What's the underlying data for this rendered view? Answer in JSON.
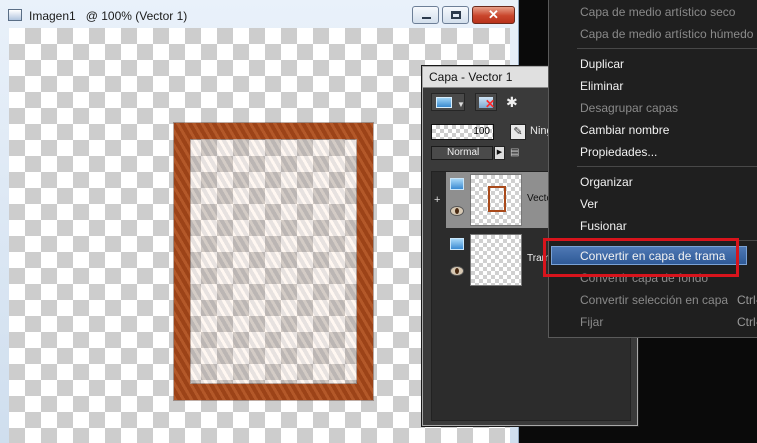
{
  "image_window": {
    "doc_name": "Imagen1",
    "zoom_info": "@ 100% (Vector 1)",
    "close_glyph": "✕"
  },
  "layer_panel": {
    "title": "Capa - Vector 1",
    "opacity": "100",
    "mode_label": "Ning",
    "blend_mode": "Normal",
    "layers": [
      {
        "name": "Vector",
        "type": "vector",
        "selected": true,
        "visible": true,
        "expand": "+"
      },
      {
        "name": "Tram",
        "type": "raster",
        "selected": false,
        "visible": true
      }
    ]
  },
  "context_menu": {
    "items": [
      {
        "label": "Capa de medio artístico seco",
        "enabled": false
      },
      {
        "label": "Capa de medio artístico húmedo",
        "enabled": false
      },
      {
        "label": "Duplicar",
        "enabled": true
      },
      {
        "label": "Eliminar",
        "enabled": true
      },
      {
        "label": "Desagrupar capas",
        "enabled": false
      },
      {
        "label": "Cambiar nombre",
        "enabled": true
      },
      {
        "label": "Propiedades...",
        "enabled": true
      },
      {
        "label": "Organizar",
        "enabled": true
      },
      {
        "label": "Ver",
        "enabled": true
      },
      {
        "label": "Fusionar",
        "enabled": true
      },
      {
        "label": "Convertir en capa de trama",
        "enabled": true,
        "highlighted": true
      },
      {
        "label": "Convertir capa de fondo",
        "enabled": false
      },
      {
        "label": "Convertir selección en capa",
        "enabled": false,
        "shortcut": "Ctrl-"
      },
      {
        "label": "Fijar",
        "enabled": false,
        "shortcut": "Ctrl-"
      }
    ]
  },
  "colors": {
    "frame": "#a94a1b",
    "highlight_border": "#d8141c",
    "menu_highlight": "#3e6aa8"
  }
}
